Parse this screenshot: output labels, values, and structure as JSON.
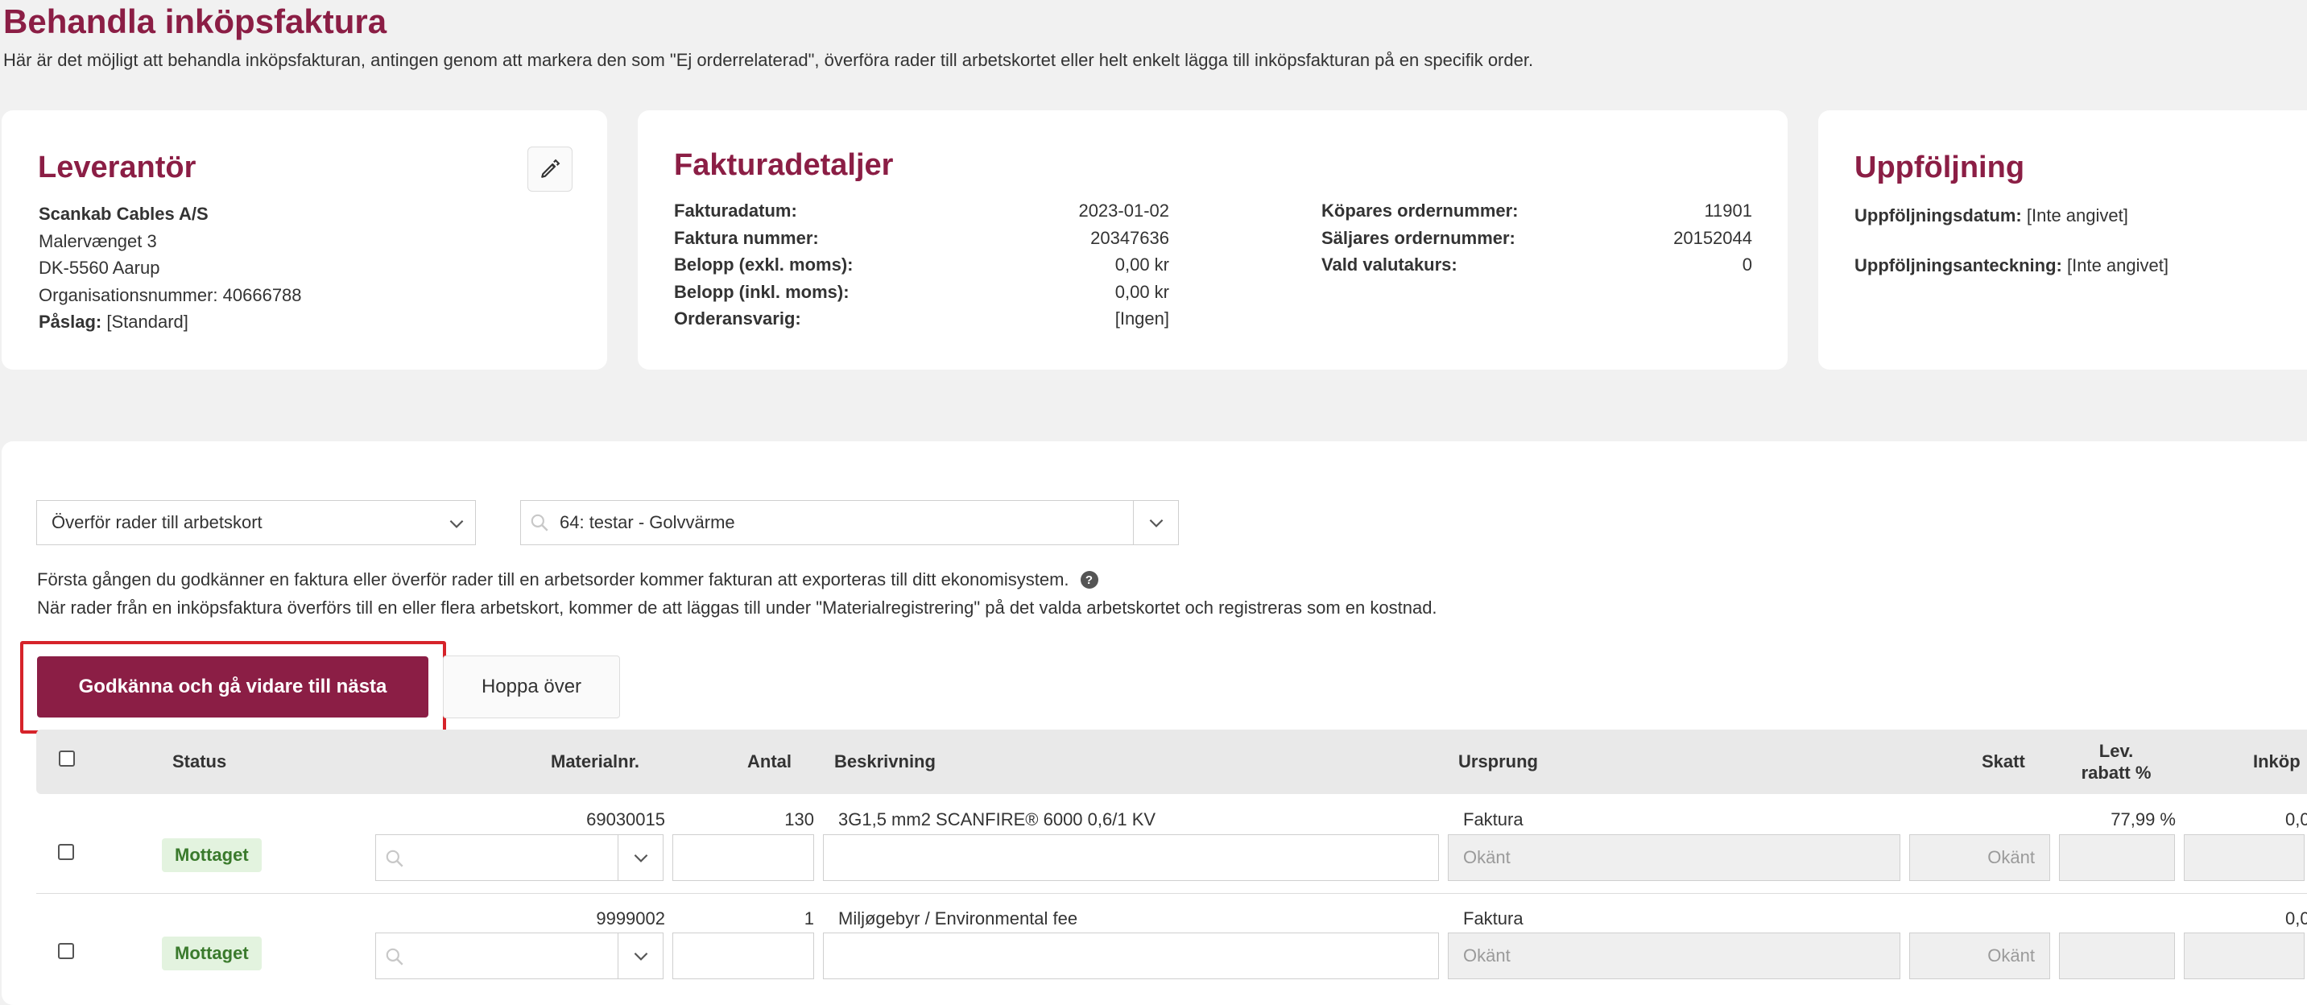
{
  "page": {
    "title": "Behandla inköpsfaktura",
    "description": "Här är det möjligt att behandla inköpsfakturan, antingen genom att markera den som \"Ej orderrelaterad\", överföra rader till arbetskortet eller helt enkelt lägga till inköpsfakturan på en specifik order."
  },
  "supplier": {
    "title": "Leverantör",
    "name": "Scankab Cables A/S",
    "address1": "Malervænget 3",
    "address2": "DK-5560 Aarup",
    "org_number": "Organisationsnummer: 40666788",
    "markup_label": "Påslag:",
    "markup_value": "[Standard]",
    "edit_icon": "pencil-icon"
  },
  "details": {
    "title": "Fakturadetaljer",
    "left": [
      {
        "label": "Fakturadatum:",
        "value": "2023-01-02"
      },
      {
        "label": "Faktura nummer:",
        "value": "20347636"
      },
      {
        "label": "Belopp (exkl. moms):",
        "value": "0,00 kr"
      },
      {
        "label": "Belopp (inkl. moms):",
        "value": "0,00 kr"
      },
      {
        "label": "Orderansvarig:",
        "value": "[Ingen]"
      }
    ],
    "right": [
      {
        "label": "Köpares ordernummer:",
        "value": "11901"
      },
      {
        "label": "Säljares ordernummer:",
        "value": "20152044"
      },
      {
        "label": "Vald valutakurs:",
        "value": "0"
      }
    ]
  },
  "followup": {
    "title": "Uppföljning",
    "date_label": "Uppföljningsdatum:",
    "date_value": "[Inte angivet]",
    "note_label": "Uppföljningsanteckning:",
    "note_value": "[Inte angivet]"
  },
  "actions": {
    "select_value": "Överför rader till arbetskort",
    "workcard_value": "64: testar - Golvvärme",
    "info_line1": "Första gången du godkänner en faktura eller överför rader till en arbetsorder kommer fakturan att exporteras till ditt ekonomisystem.",
    "info_line2": "När rader från en inköpsfaktura överförs till en eller flera arbetskort, kommer de att läggas till under \"Materialregistrering\" på det valda arbetskortet och registreras som en kostnad.",
    "help_glyph": "?",
    "approve_label": "Godkänna och gå vidare till nästa",
    "skip_label": "Hoppa över"
  },
  "table": {
    "headers": {
      "status": "Status",
      "material": "Materialnr.",
      "quantity": "Antal",
      "description": "Beskrivning",
      "origin": "Ursprung",
      "tax": "Skatt",
      "discount_line1": "Lev.",
      "discount_line2": "rabatt %",
      "purchase": "Inköp"
    },
    "rows": [
      {
        "status": "Mottaget",
        "material": "69030015",
        "quantity": "130",
        "description": "3G1,5 mm2 SCANFIRE® 6000 0,6/1 KV",
        "origin": "Faktura",
        "discount": "77,99 %",
        "purchase": "0,0",
        "origin_placeholder": "Okänt",
        "tax_placeholder": "Okänt"
      },
      {
        "status": "Mottaget",
        "material": "9999002",
        "quantity": "1",
        "description": "Miljøgebyr / Environmental fee",
        "origin": "Faktura",
        "discount": "",
        "purchase": "0,0",
        "origin_placeholder": "Okänt",
        "tax_placeholder": "Okänt"
      }
    ]
  },
  "colors": {
    "accent": "#8b1e45",
    "status_green_bg": "#e3f3df",
    "status_green_text": "#3a7a2c",
    "highlight_red": "#d6232a"
  }
}
